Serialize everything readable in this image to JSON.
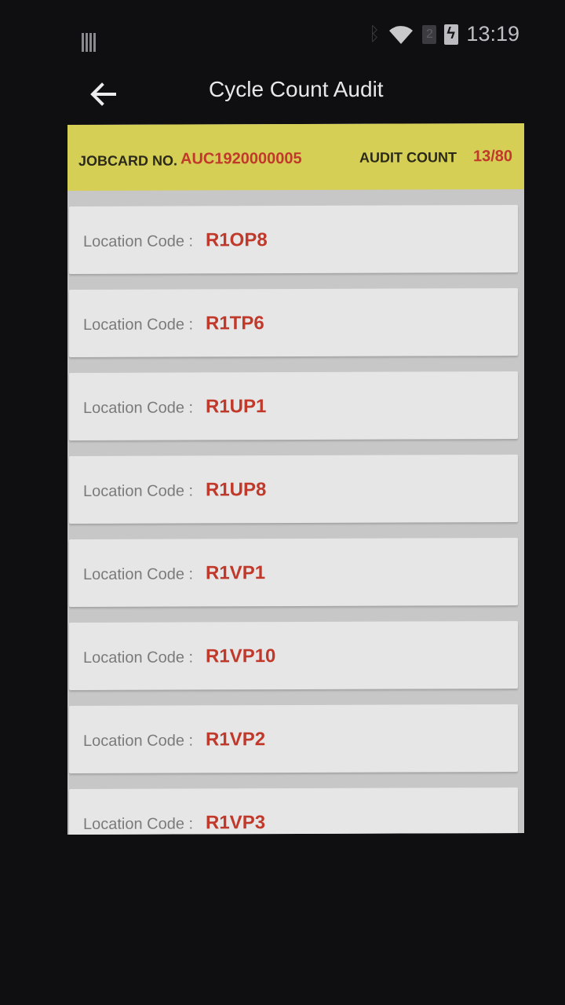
{
  "status_bar": {
    "time": "13:19",
    "sim_badge": "2"
  },
  "header": {
    "title": "Cycle Count Audit"
  },
  "info_bar": {
    "jobcard_label": "JOBCARD NO.",
    "jobcard_value": "AUC1920000005",
    "audit_count_label": "AUDIT COUNT",
    "audit_count_value": "13/80"
  },
  "locations": {
    "label": "Location Code :",
    "items": [
      "R1OP8",
      "R1TP6",
      "R1UP1",
      "R1UP8",
      "R1VP1",
      "R1VP10",
      "R1VP2",
      "R1VP3"
    ]
  },
  "colors": {
    "info_bar_bg": "#d6cf55",
    "accent_red": "#c0392b",
    "card_bg": "#e6e6e6"
  }
}
